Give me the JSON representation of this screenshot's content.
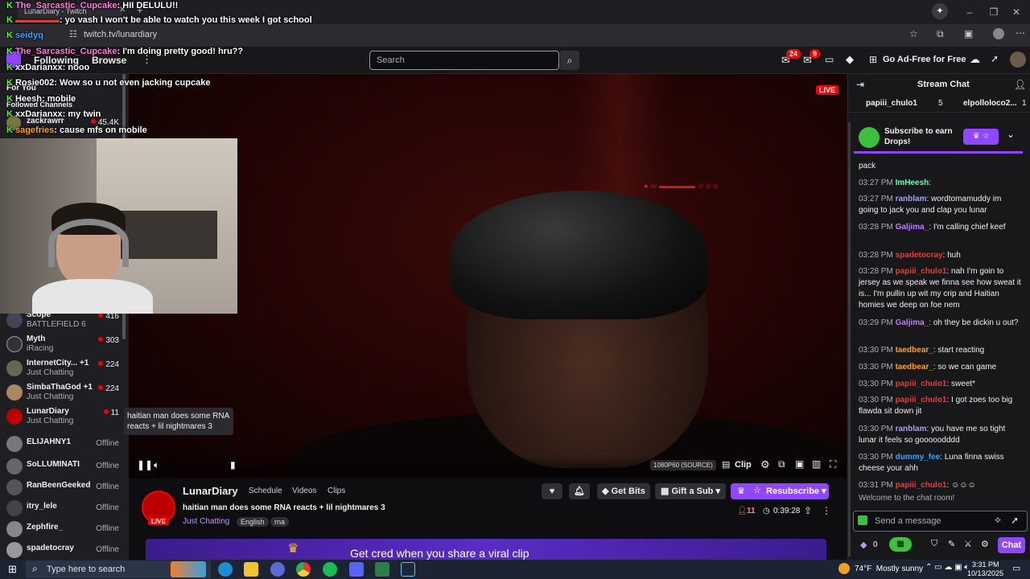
{
  "browser": {
    "tab_title": "LunarDiary - Twitch",
    "url": "twitch.tv/lunardiary"
  },
  "overlay_chat": [
    {
      "user": "The_Sarcastic_Cupcake",
      "text": ": HII DELULU!!"
    },
    {
      "user": "",
      "text": ": yo vash I won't be able to watch you this week I got school"
    },
    {
      "user": "seidyq",
      "text": ""
    },
    {
      "user": "The_Sarcastic_Cupcake",
      "text": ": I'm doing pretty good! hru??"
    },
    {
      "user": "xxDarianxx",
      "text": ": nooo"
    },
    {
      "user": "Rosie002",
      "text": ": Wow so u not even jacking cupcake"
    },
    {
      "user": "Heesh",
      "text": ": mobile"
    },
    {
      "user": "xxDarianxx",
      "text": ": my twin"
    },
    {
      "user": "sagefries",
      "text": ": cause mfs on mobile"
    }
  ],
  "nav": {
    "following": "Following",
    "browse": "Browse",
    "search_placeholder": "Search",
    "notif_count": "24",
    "inbox_count": "9",
    "ad_free": "Go Ad-Free for Free"
  },
  "sidebar": {
    "for_you": "For You",
    "followed": "Followed Channels",
    "top_name": "zackrawrr",
    "top_count": "45.4K",
    "items": [
      {
        "name": "Scope",
        "game": "BATTLEFIELD 6",
        "count": "416"
      },
      {
        "name": "Myth",
        "game": "iRacing",
        "count": "303"
      },
      {
        "name": "InternetCity... +1",
        "game": "Just Chatting",
        "count": "224"
      },
      {
        "name": "SimbaThaGod +1",
        "game": "Just Chatting",
        "count": "224"
      },
      {
        "name": "LunarDiary",
        "game": "Just Chatting",
        "count": "11"
      },
      {
        "name": "ELIJAHNY1",
        "game": "",
        "count": "Offline"
      },
      {
        "name": "SoLLUMINATI",
        "game": "",
        "count": "Offline"
      },
      {
        "name": "RanBeenGeeked",
        "game": "",
        "count": "Offline"
      },
      {
        "name": "itry_lele",
        "game": "",
        "count": "Offline"
      },
      {
        "name": "Zephfire_",
        "game": "",
        "count": "Offline"
      },
      {
        "name": "spadetocray",
        "game": "",
        "count": "Offline"
      }
    ]
  },
  "video": {
    "live": "LIVE",
    "tooltip": "haitian man does some RNA reacts + lil nightmares 3",
    "quality": "1080P60 (SOURCE)",
    "clip": "Clip"
  },
  "stream": {
    "channel": "LunarDiary",
    "schedule": "Schedule",
    "videos": "Videos",
    "clips": "Clips",
    "title": "haitian man does some RNA reacts + lil nightmares 3",
    "category": "Just Chatting",
    "tags": [
      "English",
      "rna"
    ],
    "viewers": "11",
    "uptime": "0:39:28",
    "get_bits": "Get Bits",
    "gift_sub": "Gift a Sub",
    "resubscribe": "Resubscribe",
    "live_badge": "LIVE",
    "banner": "Get cred when you share a viral clip"
  },
  "chat": {
    "title": "Stream Chat",
    "leader1": "papiii_chulo1",
    "leader1_count": "5",
    "leader2": "elpolloloco2...",
    "leader2_count": "1",
    "drops": "Subscribe to earn Drops!",
    "messages": [
      {
        "time": "",
        "user": "",
        "color": "#efeff1",
        "text": "pack"
      },
      {
        "time": "03:27 PM",
        "user": "ImHeesh",
        "color": "#5cffb4",
        "text": ":"
      },
      {
        "time": "03:27 PM",
        "user": "ranblam",
        "color": "#a0a0ff",
        "text": ": wordtomamuddy im going to jack you and clap you lunar"
      },
      {
        "time": "03:28 PM",
        "user": "Galjima_",
        "color": "#c17bff",
        "text": ": I'm calling chief keef"
      },
      {
        "time": "03:28 PM",
        "user": "spadetocray",
        "color": "#ff3030",
        "text": ": huh"
      },
      {
        "time": "03:28 PM",
        "user": "papiii_chulo1",
        "color": "#ff3030",
        "text": ": nah I'm goin to jersey as we speak we finna see how sweat it is... I'm pullin up wit my crip and Haitian homies we deep on foe nem"
      },
      {
        "time": "03:29 PM",
        "user": "Galjima_",
        "color": "#c17bff",
        "text": ": oh they be dickin u out?"
      },
      {
        "time": "03:30 PM",
        "user": "taedbear_",
        "color": "#ff9f1a",
        "text": ": start reacting"
      },
      {
        "time": "03:30 PM",
        "user": "taedbear_",
        "color": "#ff9f1a",
        "text": ": so we can game"
      },
      {
        "time": "03:30 PM",
        "user": "papiii_chulo1",
        "color": "#ff3030",
        "text": ": sweet*"
      },
      {
        "time": "03:30 PM",
        "user": "papiii_chulo1",
        "color": "#ff3030",
        "text": ": I got zoes too big flawda sit down jit"
      },
      {
        "time": "03:30 PM",
        "user": "ranblam",
        "color": "#a0a0ff",
        "text": ": you have me so tight lunar it feels so gooooodddd"
      },
      {
        "time": "03:30 PM",
        "user": "dummy_fee",
        "color": "#3aa0ff",
        "text": ": Luna finna swiss cheese your ahh"
      },
      {
        "time": "03:31 PM",
        "user": "papiii_chulo1",
        "color": "#ff3030",
        "text": ":"
      }
    ],
    "welcome": "Welcome to the chat room!",
    "placeholder": "Send a message",
    "points": "0",
    "send": "Chat"
  },
  "taskbar": {
    "search": "Type here to search",
    "weather": "74°F  Mostly sunny",
    "time": "3:31 PM",
    "date": "10/13/2025"
  }
}
